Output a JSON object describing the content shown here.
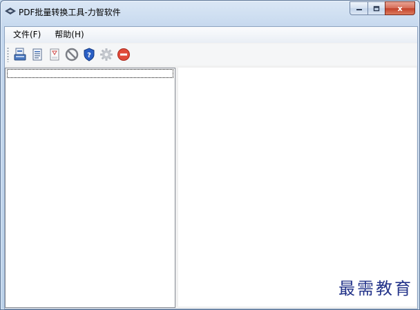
{
  "window": {
    "title": "PDF批量转换工具-力智软件"
  },
  "caption_buttons": {
    "minimize": "–",
    "maximize": "□",
    "close": "x"
  },
  "menu": {
    "items": [
      {
        "label": "文件(F)"
      },
      {
        "label": "帮助(H)"
      }
    ]
  },
  "toolbar": {
    "buttons": [
      {
        "icon": "pdf-to-word-icon"
      },
      {
        "icon": "word-document-icon"
      },
      {
        "icon": "pdf-document-icon"
      },
      {
        "icon": "stop-icon"
      },
      {
        "icon": "help-shield-icon"
      },
      {
        "icon": "settings-gear-icon"
      },
      {
        "icon": "exit-icon"
      }
    ]
  },
  "watermark": {
    "text": "最需教育"
  },
  "colors": {
    "close_button": "#c2412a",
    "exit_icon": "#e04a3a",
    "help_icon": "#2a5fc4"
  }
}
